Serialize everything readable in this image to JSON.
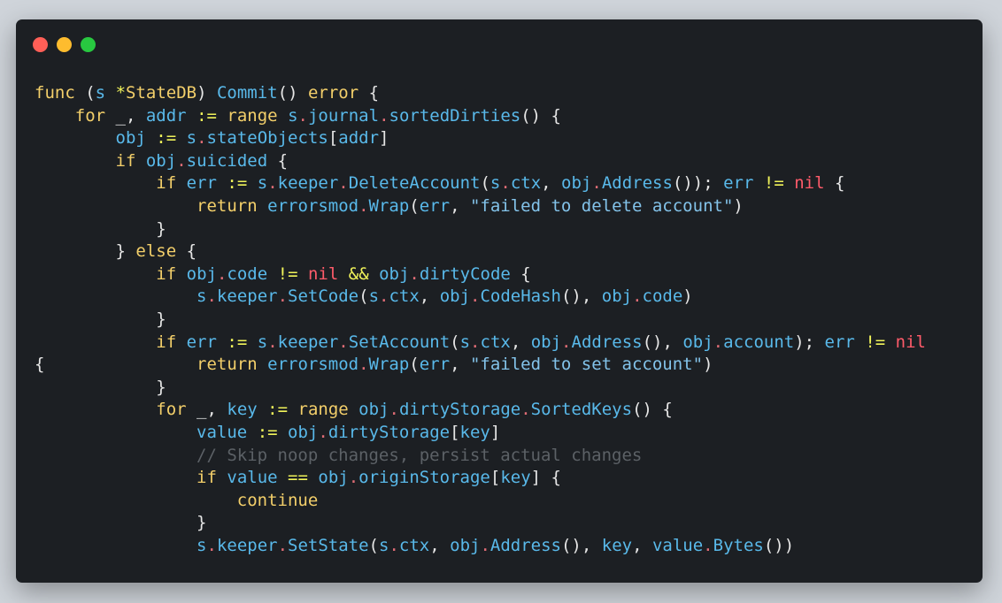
{
  "window": {
    "controls": [
      "close",
      "minimize",
      "zoom"
    ],
    "colors": {
      "close": "#ff5f57",
      "minimize": "#febc2e",
      "zoom": "#28c840",
      "background": "#1c1f23"
    }
  },
  "code": {
    "language": "go",
    "lines": [
      [
        [
          "kw",
          "func"
        ],
        [
          "plain",
          " ("
        ],
        [
          "id",
          "s"
        ],
        [
          "plain",
          " "
        ],
        [
          "op",
          "*"
        ],
        [
          "kw",
          "StateDB"
        ],
        [
          "plain",
          ") "
        ],
        [
          "fn",
          "Commit"
        ],
        [
          "plain",
          "() "
        ],
        [
          "kw",
          "error"
        ],
        [
          "plain",
          " {"
        ]
      ],
      [
        [
          "plain",
          "    "
        ],
        [
          "kw",
          "for"
        ],
        [
          "plain",
          " _, "
        ],
        [
          "id",
          "addr"
        ],
        [
          "plain",
          " "
        ],
        [
          "op",
          ":="
        ],
        [
          "plain",
          " "
        ],
        [
          "kw",
          "range"
        ],
        [
          "plain",
          " "
        ],
        [
          "id",
          "s"
        ],
        [
          "dot-op",
          "."
        ],
        [
          "id",
          "journal"
        ],
        [
          "dot-op",
          "."
        ],
        [
          "fn",
          "sortedDirties"
        ],
        [
          "plain",
          "() {"
        ]
      ],
      [
        [
          "plain",
          "        "
        ],
        [
          "id",
          "obj"
        ],
        [
          "plain",
          " "
        ],
        [
          "op",
          ":="
        ],
        [
          "plain",
          " "
        ],
        [
          "id",
          "s"
        ],
        [
          "dot-op",
          "."
        ],
        [
          "id",
          "stateObjects"
        ],
        [
          "plain",
          "["
        ],
        [
          "id",
          "addr"
        ],
        [
          "plain",
          "]"
        ]
      ],
      [
        [
          "plain",
          "        "
        ],
        [
          "kw",
          "if"
        ],
        [
          "plain",
          " "
        ],
        [
          "id",
          "obj"
        ],
        [
          "dot-op",
          "."
        ],
        [
          "id",
          "suicided"
        ],
        [
          "plain",
          " {"
        ]
      ],
      [
        [
          "plain",
          "            "
        ],
        [
          "kw",
          "if"
        ],
        [
          "plain",
          " "
        ],
        [
          "id",
          "err"
        ],
        [
          "plain",
          " "
        ],
        [
          "op",
          ":="
        ],
        [
          "plain",
          " "
        ],
        [
          "id",
          "s"
        ],
        [
          "dot-op",
          "."
        ],
        [
          "id",
          "keeper"
        ],
        [
          "dot-op",
          "."
        ],
        [
          "fn",
          "DeleteAccount"
        ],
        [
          "plain",
          "("
        ],
        [
          "id",
          "s"
        ],
        [
          "dot-op",
          "."
        ],
        [
          "id",
          "ctx"
        ],
        [
          "plain",
          ", "
        ],
        [
          "id",
          "obj"
        ],
        [
          "dot-op",
          "."
        ],
        [
          "fn",
          "Address"
        ],
        [
          "plain",
          "()); "
        ],
        [
          "id",
          "err"
        ],
        [
          "plain",
          " "
        ],
        [
          "op",
          "!="
        ],
        [
          "plain",
          " "
        ],
        [
          "nil",
          "nil"
        ],
        [
          "plain",
          " {"
        ]
      ],
      [
        [
          "plain",
          "                "
        ],
        [
          "kw",
          "return"
        ],
        [
          "plain",
          " "
        ],
        [
          "id",
          "errorsmod"
        ],
        [
          "dot-op",
          "."
        ],
        [
          "fn",
          "Wrap"
        ],
        [
          "plain",
          "("
        ],
        [
          "id",
          "err"
        ],
        [
          "plain",
          ", "
        ],
        [
          "str",
          "\"failed to delete account\""
        ],
        [
          "plain",
          ")"
        ]
      ],
      [
        [
          "plain",
          "            }"
        ]
      ],
      [
        [
          "plain",
          "        } "
        ],
        [
          "kw",
          "else"
        ],
        [
          "plain",
          " {"
        ]
      ],
      [
        [
          "plain",
          "            "
        ],
        [
          "kw",
          "if"
        ],
        [
          "plain",
          " "
        ],
        [
          "id",
          "obj"
        ],
        [
          "dot-op",
          "."
        ],
        [
          "id",
          "code"
        ],
        [
          "plain",
          " "
        ],
        [
          "op",
          "!="
        ],
        [
          "plain",
          " "
        ],
        [
          "nil",
          "nil"
        ],
        [
          "plain",
          " "
        ],
        [
          "op",
          "&&"
        ],
        [
          "plain",
          " "
        ],
        [
          "id",
          "obj"
        ],
        [
          "dot-op",
          "."
        ],
        [
          "id",
          "dirtyCode"
        ],
        [
          "plain",
          " {"
        ]
      ],
      [
        [
          "plain",
          "                "
        ],
        [
          "id",
          "s"
        ],
        [
          "dot-op",
          "."
        ],
        [
          "id",
          "keeper"
        ],
        [
          "dot-op",
          "."
        ],
        [
          "fn",
          "SetCode"
        ],
        [
          "plain",
          "("
        ],
        [
          "id",
          "s"
        ],
        [
          "dot-op",
          "."
        ],
        [
          "id",
          "ctx"
        ],
        [
          "plain",
          ", "
        ],
        [
          "id",
          "obj"
        ],
        [
          "dot-op",
          "."
        ],
        [
          "fn",
          "CodeHash"
        ],
        [
          "plain",
          "(), "
        ],
        [
          "id",
          "obj"
        ],
        [
          "dot-op",
          "."
        ],
        [
          "id",
          "code"
        ],
        [
          "plain",
          ")"
        ]
      ],
      [
        [
          "plain",
          "            }"
        ]
      ],
      [
        [
          "plain",
          "            "
        ],
        [
          "kw",
          "if"
        ],
        [
          "plain",
          " "
        ],
        [
          "id",
          "err"
        ],
        [
          "plain",
          " "
        ],
        [
          "op",
          ":="
        ],
        [
          "plain",
          " "
        ],
        [
          "id",
          "s"
        ],
        [
          "dot-op",
          "."
        ],
        [
          "id",
          "keeper"
        ],
        [
          "dot-op",
          "."
        ],
        [
          "fn",
          "SetAccount"
        ],
        [
          "plain",
          "("
        ],
        [
          "id",
          "s"
        ],
        [
          "dot-op",
          "."
        ],
        [
          "id",
          "ctx"
        ],
        [
          "plain",
          ", "
        ],
        [
          "id",
          "obj"
        ],
        [
          "dot-op",
          "."
        ],
        [
          "fn",
          "Address"
        ],
        [
          "plain",
          "(), "
        ],
        [
          "id",
          "obj"
        ],
        [
          "dot-op",
          "."
        ],
        [
          "id",
          "account"
        ],
        [
          "plain",
          "); "
        ],
        [
          "id",
          "err"
        ],
        [
          "plain",
          " "
        ],
        [
          "op",
          "!="
        ],
        [
          "plain",
          " "
        ],
        [
          "nil",
          "nil"
        ]
      ],
      [
        [
          "plain",
          "{               "
        ],
        [
          "kw",
          "return"
        ],
        [
          "plain",
          " "
        ],
        [
          "id",
          "errorsmod"
        ],
        [
          "dot-op",
          "."
        ],
        [
          "fn",
          "Wrap"
        ],
        [
          "plain",
          "("
        ],
        [
          "id",
          "err"
        ],
        [
          "plain",
          ", "
        ],
        [
          "str",
          "\"failed to set account\""
        ],
        [
          "plain",
          ")"
        ]
      ],
      [
        [
          "plain",
          "            }"
        ]
      ],
      [
        [
          "plain",
          "            "
        ],
        [
          "kw",
          "for"
        ],
        [
          "plain",
          " _, "
        ],
        [
          "id",
          "key"
        ],
        [
          "plain",
          " "
        ],
        [
          "op",
          ":="
        ],
        [
          "plain",
          " "
        ],
        [
          "kw",
          "range"
        ],
        [
          "plain",
          " "
        ],
        [
          "id",
          "obj"
        ],
        [
          "dot-op",
          "."
        ],
        [
          "id",
          "dirtyStorage"
        ],
        [
          "dot-op",
          "."
        ],
        [
          "fn",
          "SortedKeys"
        ],
        [
          "plain",
          "() {"
        ]
      ],
      [
        [
          "plain",
          "                "
        ],
        [
          "id",
          "value"
        ],
        [
          "plain",
          " "
        ],
        [
          "op",
          ":="
        ],
        [
          "plain",
          " "
        ],
        [
          "id",
          "obj"
        ],
        [
          "dot-op",
          "."
        ],
        [
          "id",
          "dirtyStorage"
        ],
        [
          "plain",
          "["
        ],
        [
          "id",
          "key"
        ],
        [
          "plain",
          "]"
        ]
      ],
      [
        [
          "plain",
          "                "
        ],
        [
          "cmt",
          "// Skip noop changes, persist actual changes"
        ]
      ],
      [
        [
          "plain",
          "                "
        ],
        [
          "kw",
          "if"
        ],
        [
          "plain",
          " "
        ],
        [
          "id",
          "value"
        ],
        [
          "plain",
          " "
        ],
        [
          "op",
          "=="
        ],
        [
          "plain",
          " "
        ],
        [
          "id",
          "obj"
        ],
        [
          "dot-op",
          "."
        ],
        [
          "id",
          "originStorage"
        ],
        [
          "plain",
          "["
        ],
        [
          "id",
          "key"
        ],
        [
          "plain",
          "] {"
        ]
      ],
      [
        [
          "plain",
          "                    "
        ],
        [
          "kw",
          "continue"
        ]
      ],
      [
        [
          "plain",
          "                }"
        ]
      ],
      [
        [
          "plain",
          "                "
        ],
        [
          "id",
          "s"
        ],
        [
          "dot-op",
          "."
        ],
        [
          "id",
          "keeper"
        ],
        [
          "dot-op",
          "."
        ],
        [
          "fn",
          "SetState"
        ],
        [
          "plain",
          "("
        ],
        [
          "id",
          "s"
        ],
        [
          "dot-op",
          "."
        ],
        [
          "id",
          "ctx"
        ],
        [
          "plain",
          ", "
        ],
        [
          "id",
          "obj"
        ],
        [
          "dot-op",
          "."
        ],
        [
          "fn",
          "Address"
        ],
        [
          "plain",
          "(), "
        ],
        [
          "id",
          "key"
        ],
        [
          "plain",
          ", "
        ],
        [
          "id",
          "value"
        ],
        [
          "dot-op",
          "."
        ],
        [
          "fn",
          "Bytes"
        ],
        [
          "plain",
          "())"
        ]
      ]
    ]
  }
}
